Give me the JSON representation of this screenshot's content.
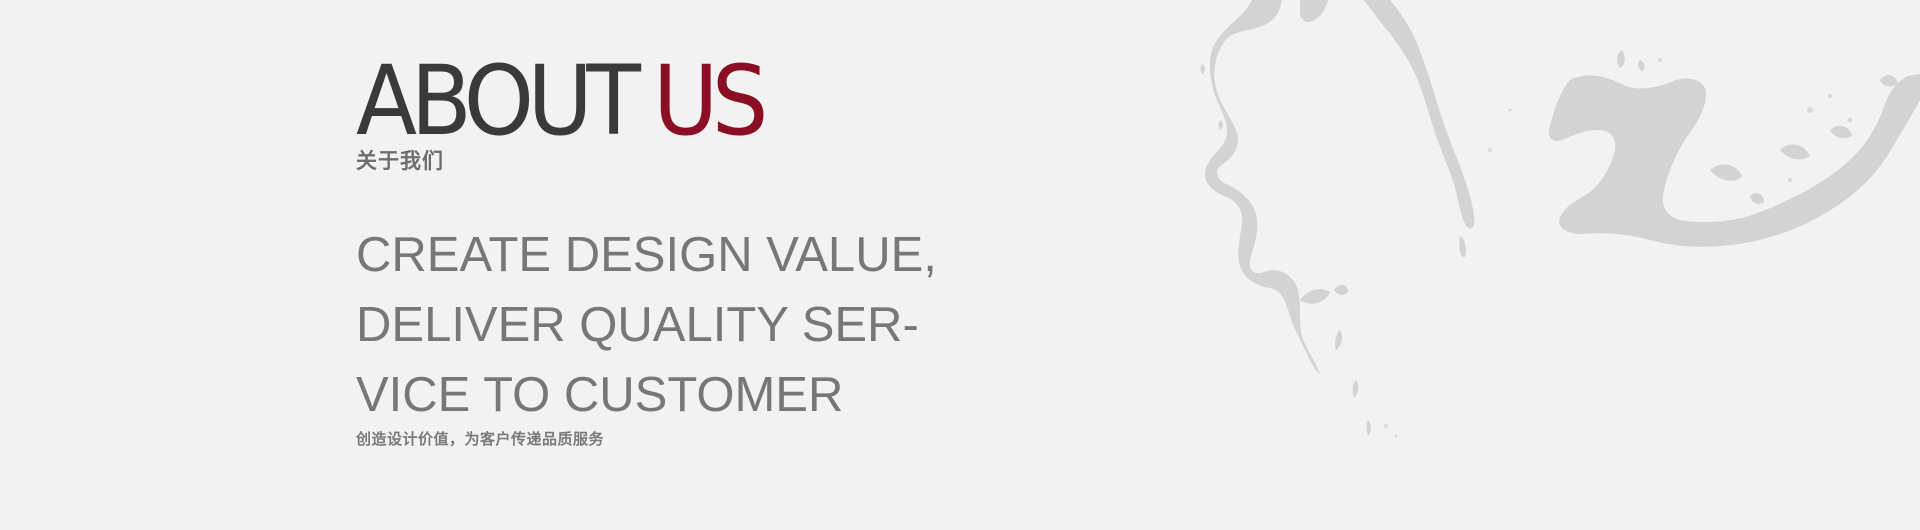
{
  "about": {
    "title_main": "ABOUT",
    "title_accent": "US",
    "subtitle_cn": "关于我们"
  },
  "slogan": {
    "lines": [
      "CREATE DESIGN VALUE,",
      "DELIVER QUALITY SER-",
      "VICE TO CUSTOMER"
    ],
    "cn": "创造设计价值，为客户传递品质服务"
  },
  "colors": {
    "background": "#f2f2f2",
    "title_dark": "#3a3a3a",
    "accent": "#8b0e24",
    "text_gray": "#777777",
    "splash": "#d2d2d2"
  },
  "decoration": {
    "icon": "ink-splash-icon"
  }
}
